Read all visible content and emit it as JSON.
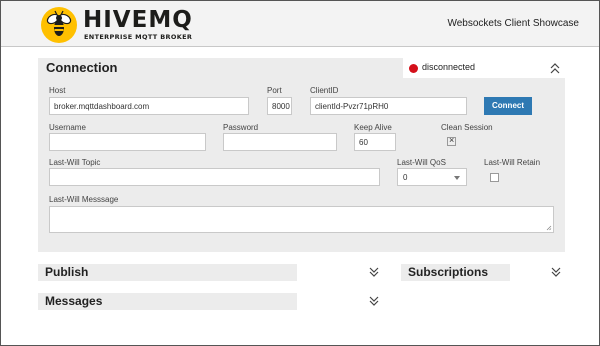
{
  "header": {
    "logo_name": "HIVEMQ",
    "logo_subtitle": "ENTERPRISE MQTT BROKER",
    "logo_icon": "bee-icon",
    "title": "Websockets Client Showcase"
  },
  "connection": {
    "title": "Connection",
    "status": "disconnected",
    "status_color": "#d4101a",
    "collapse_icon": "chevron-double-up-icon",
    "host": {
      "label": "Host",
      "value": "broker.mqttdashboard.com"
    },
    "port": {
      "label": "Port",
      "value": "8000"
    },
    "client_id": {
      "label": "ClientID",
      "value": "clientId-Pvzr71pRH0"
    },
    "connect_label": "Connect",
    "connect_color": "#2e79b3",
    "username": {
      "label": "Username",
      "value": ""
    },
    "password": {
      "label": "Password",
      "value": ""
    },
    "keep_alive": {
      "label": "Keep Alive",
      "value": "60"
    },
    "clean_session": {
      "label": "Clean Session",
      "checked": true
    },
    "lw_topic": {
      "label": "Last-Will Topic",
      "value": ""
    },
    "lw_qos": {
      "label": "Last-Will QoS",
      "value": "0"
    },
    "lw_retain": {
      "label": "Last-Will Retain",
      "checked": false
    },
    "lw_message": {
      "label": "Last-Will Messsage",
      "value": ""
    }
  },
  "panels": {
    "publish": {
      "title": "Publish",
      "icon": "chevron-double-down-icon"
    },
    "subscriptions": {
      "title": "Subscriptions",
      "icon": "chevron-double-down-icon"
    },
    "messages": {
      "title": "Messages",
      "icon": "chevron-double-down-icon"
    }
  }
}
